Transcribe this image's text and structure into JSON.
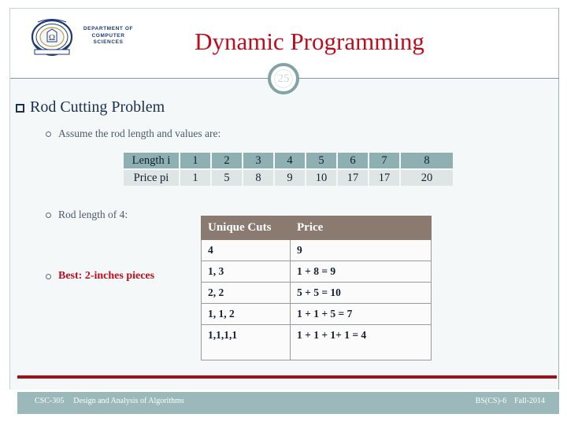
{
  "header": {
    "title": "Dynamic Programming",
    "slide_number": "25",
    "logo": {
      "line1": "DEPARTMENT OF",
      "line2": "COMPUTER",
      "line3": "SCIENCES"
    }
  },
  "content": {
    "heading": "Rod Cutting Problem",
    "bullet_assume": "Assume the rod length and values are:",
    "bullet_rod_length": "Rod length of 4:",
    "bullet_best": "Best: 2-inches pieces"
  },
  "length_price_table": {
    "row_labels": [
      "Length i",
      "Price pi"
    ],
    "lengths": [
      "1",
      "2",
      "3",
      "4",
      "5",
      "6",
      "7",
      "8"
    ],
    "prices": [
      "1",
      "5",
      "8",
      "9",
      "10",
      "17",
      "17",
      "20"
    ]
  },
  "cuts_table": {
    "headers": [
      "Unique Cuts",
      "Price"
    ],
    "rows": [
      {
        "cuts": "4",
        "price": "9"
      },
      {
        "cuts": "1, 3",
        "price": "1 + 8 = 9"
      },
      {
        "cuts": "2, 2",
        "price": "5 + 5 = 10"
      },
      {
        "cuts": "1, 1, 2",
        "price": "1 + 1 + 5 = 7"
      },
      {
        "cuts": "1,1,1,1",
        "price": "1 + 1 + 1+ 1 = 4"
      }
    ]
  },
  "footer": {
    "course_code": "CSC-305",
    "course_name": "Design and Analysis of Algorithms",
    "program": "BS(CS)-6",
    "term": "Fall-2014"
  },
  "colors": {
    "title_red": "#c00d1e",
    "teal": "#8fb0b2",
    "taupe": "#8a7a70",
    "navy": "#19304f",
    "rule_red": "#9e0f16"
  }
}
